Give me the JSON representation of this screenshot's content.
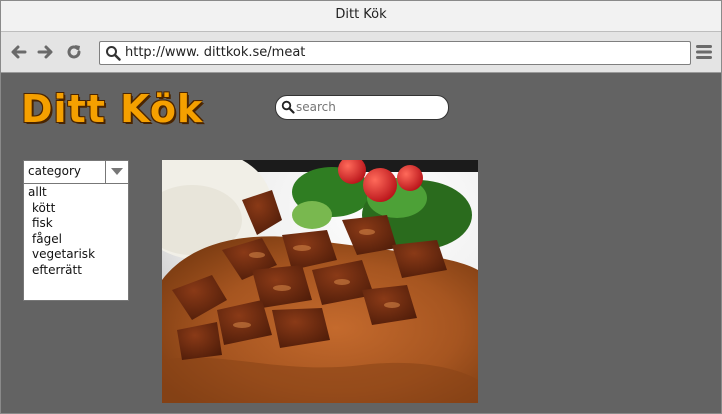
{
  "window": {
    "title": "Ditt Kök"
  },
  "toolbar": {
    "url": "http://www. dittkok.se/meat",
    "back_icon": "arrow-left-icon",
    "forward_icon": "arrow-right-icon",
    "reload_icon": "reload-icon",
    "menu_icon": "hamburger-menu-icon"
  },
  "header": {
    "logo_text": "Ditt Kök",
    "search_placeholder": "search"
  },
  "category": {
    "selected": "category",
    "options": [
      "allt",
      "kött",
      "fisk",
      "fågel",
      "vegetarisk",
      "efterrätt"
    ]
  },
  "colors": {
    "background": "#636363",
    "logo": "#f5a000",
    "logo_outline": "#4b2500"
  }
}
